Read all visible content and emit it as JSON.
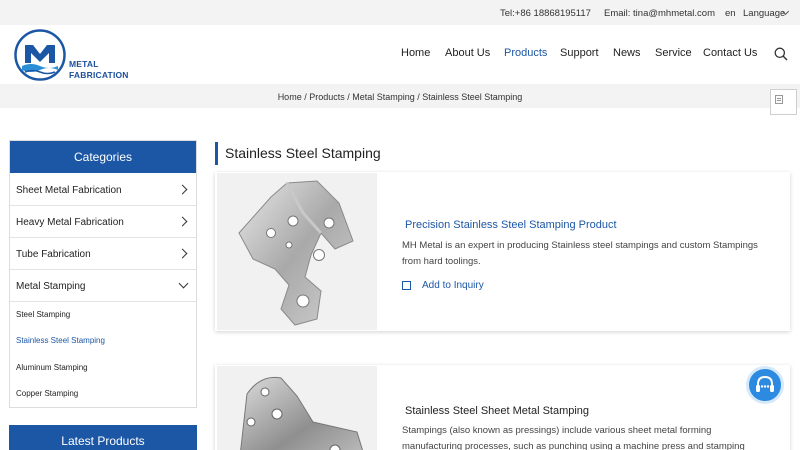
{
  "topbar": {
    "tel": "Tel:+86 18868195117",
    "email": "Email: tina@mhmetal.com",
    "lang_code": "en",
    "language": "Language"
  },
  "brand": {
    "line1": "METAL",
    "line2": "FABRICATION",
    "color": "#1c57a5"
  },
  "nav": {
    "home": "Home",
    "about": "About Us",
    "products": "Products",
    "support": "Support",
    "news": "News",
    "service": "Service",
    "contact": "Contact Us",
    "active": "Products"
  },
  "breadcrumb": "Home / Products / Metal Stamping / Stainless Steel Stamping",
  "sidebar": {
    "heading": "Categories",
    "items": [
      {
        "label": "Sheet Metal Fabrication",
        "expanded": false
      },
      {
        "label": "Heavy Metal Fabrication",
        "expanded": false
      },
      {
        "label": "Tube Fabrication",
        "expanded": false
      },
      {
        "label": "Metal Stamping",
        "expanded": true
      }
    ],
    "subitems": [
      {
        "label": "Steel Stamping",
        "active": false
      },
      {
        "label": "Stainless Steel Stamping",
        "active": true
      },
      {
        "label": "Aluminum Stamping",
        "active": false
      },
      {
        "label": "Copper Stamping",
        "active": false
      }
    ],
    "latest_heading": "Latest Products"
  },
  "main": {
    "title": "Stainless Steel Stamping",
    "products": [
      {
        "title": "Precision Stainless Steel Stamping Product",
        "description": "MH Metal is an expert in producing Stainless steel stampings and custom Stampings from hard toolings.",
        "inquiry_label": "Add to Inquiry"
      },
      {
        "title": "Stainless Steel Sheet Metal Stamping",
        "description": "Stampings (also known as pressings) include various sheet metal forming manufacturing processes, such as punching using a machine press and stamping"
      }
    ]
  },
  "icons": {
    "search": "search-icon",
    "chat": "chat-support-icon",
    "language_dropdown": "chevron-down-icon",
    "category_expand": "chevron-right-icon",
    "category_collapse": "chevron-down-icon",
    "inquiry_checkbox": "checkbox-icon",
    "share": "document-icon"
  }
}
